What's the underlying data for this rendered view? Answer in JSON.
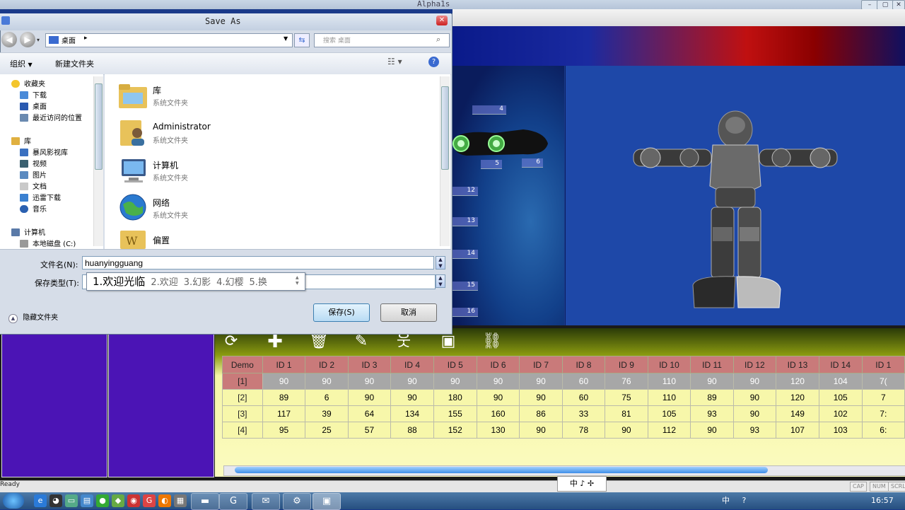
{
  "app": {
    "title": "Alpha1s",
    "status_ready": "Ready",
    "indicators": [
      "CAP",
      "NUM",
      "SCRL"
    ],
    "joint_labels": [
      "4",
      "5",
      "6",
      "12",
      "13",
      "14",
      "15",
      "16"
    ]
  },
  "dialog": {
    "title": "Save As",
    "address": "桌面",
    "address_chevron": "▸",
    "search_placeholder": "搜索 桌面",
    "organize": "组织",
    "new_folder": "新建文件夹",
    "nav": {
      "favorites": "收藏夹",
      "favorites_items": [
        "下载",
        "桌面",
        "最近访问的位置"
      ],
      "library": "库",
      "library_items": [
        "暴风影视库",
        "视频",
        "图片",
        "文档",
        "迅雷下载",
        "音乐"
      ],
      "computer": "计算机",
      "computer_items": [
        "本地磁盘 (C:)"
      ]
    },
    "files": [
      {
        "name": "库",
        "type": "系统文件夹",
        "icon": "library-folder-icon"
      },
      {
        "name": "Administrator",
        "type": "系统文件夹",
        "icon": "user-folder-icon"
      },
      {
        "name": "计算机",
        "type": "系统文件夹",
        "icon": "computer-icon"
      },
      {
        "name": "网络",
        "type": "系统文件夹",
        "icon": "network-globe-icon"
      },
      {
        "name": "偏置",
        "type": "",
        "icon": "document-folder-icon"
      }
    ],
    "filename_label": "文件名(N):",
    "filename_value": "huanyingguang",
    "filetype_label": "保存类型(T):",
    "ime_candidates": [
      "1.欢迎光临",
      "2.欢迎",
      "3.幻影",
      "4.幻樱",
      "5.换"
    ],
    "hide_folders": "隐藏文件夹",
    "save_button": "保存(S)",
    "cancel_button": "取消"
  },
  "motion_table": {
    "columns": [
      "Demo",
      "ID 1",
      "ID 2",
      "ID 3",
      "ID 4",
      "ID 5",
      "ID 6",
      "ID 7",
      "ID 8",
      "ID 9",
      "ID 10",
      "ID 11",
      "ID 12",
      "ID 13",
      "ID 14",
      "ID 1"
    ],
    "rows": [
      {
        "label": "[1]",
        "values": [
          "90",
          "90",
          "90",
          "90",
          "90",
          "90",
          "90",
          "60",
          "76",
          "110",
          "90",
          "90",
          "120",
          "104",
          "7("
        ]
      },
      {
        "label": "[2]",
        "values": [
          "89",
          "6",
          "90",
          "90",
          "180",
          "90",
          "90",
          "60",
          "75",
          "110",
          "89",
          "90",
          "120",
          "105",
          "7"
        ]
      },
      {
        "label": "[3]",
        "values": [
          "117",
          "39",
          "64",
          "134",
          "155",
          "160",
          "86",
          "33",
          "81",
          "105",
          "93",
          "90",
          "149",
          "102",
          "7:"
        ]
      },
      {
        "label": "[4]",
        "values": [
          "95",
          "25",
          "57",
          "88",
          "152",
          "130",
          "90",
          "78",
          "90",
          "112",
          "90",
          "93",
          "107",
          "103",
          "6:"
        ]
      }
    ]
  },
  "ime_bar": "中 ♪ ✢",
  "tray": {
    "items": [
      "中",
      "?"
    ],
    "clock": "16:57"
  },
  "colors": {
    "table_header": "#c97a7a",
    "row_selected": "#a7a7a7",
    "row_normal": "#f7f7aa",
    "side_panel": "#4b14b5"
  }
}
